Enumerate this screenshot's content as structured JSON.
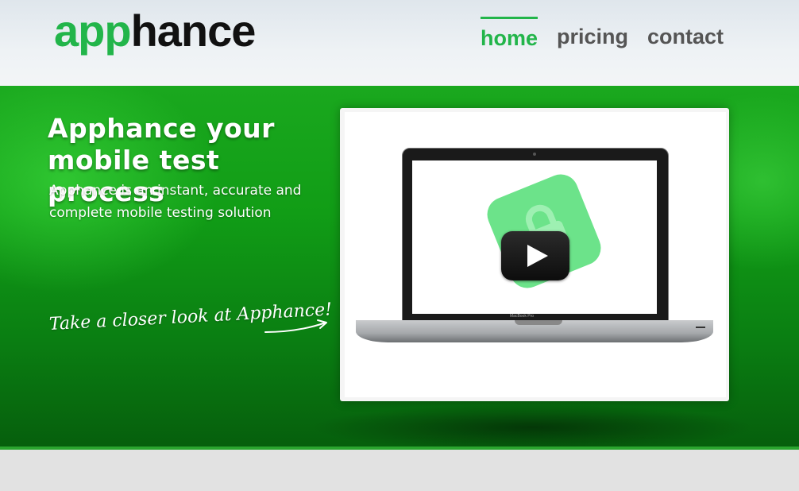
{
  "header": {
    "logo": {
      "part1": "app",
      "part2": "hance"
    },
    "nav": [
      {
        "label": "home",
        "active": true
      },
      {
        "label": "pricing",
        "active": false
      },
      {
        "label": "contact",
        "active": false
      }
    ]
  },
  "hero": {
    "title": "Apphance your mobile test process",
    "subtitle": "Apphance is an instant, accurate and complete mobile testing solution",
    "cta_text": "Take a closer look at Apphance!",
    "video": {
      "laptop_brand": "MacBook Pro",
      "play_icon": "play-icon"
    }
  },
  "colors": {
    "brand_green": "#22b54a",
    "nav_inactive": "#555555",
    "hero_green": "#119d16"
  }
}
